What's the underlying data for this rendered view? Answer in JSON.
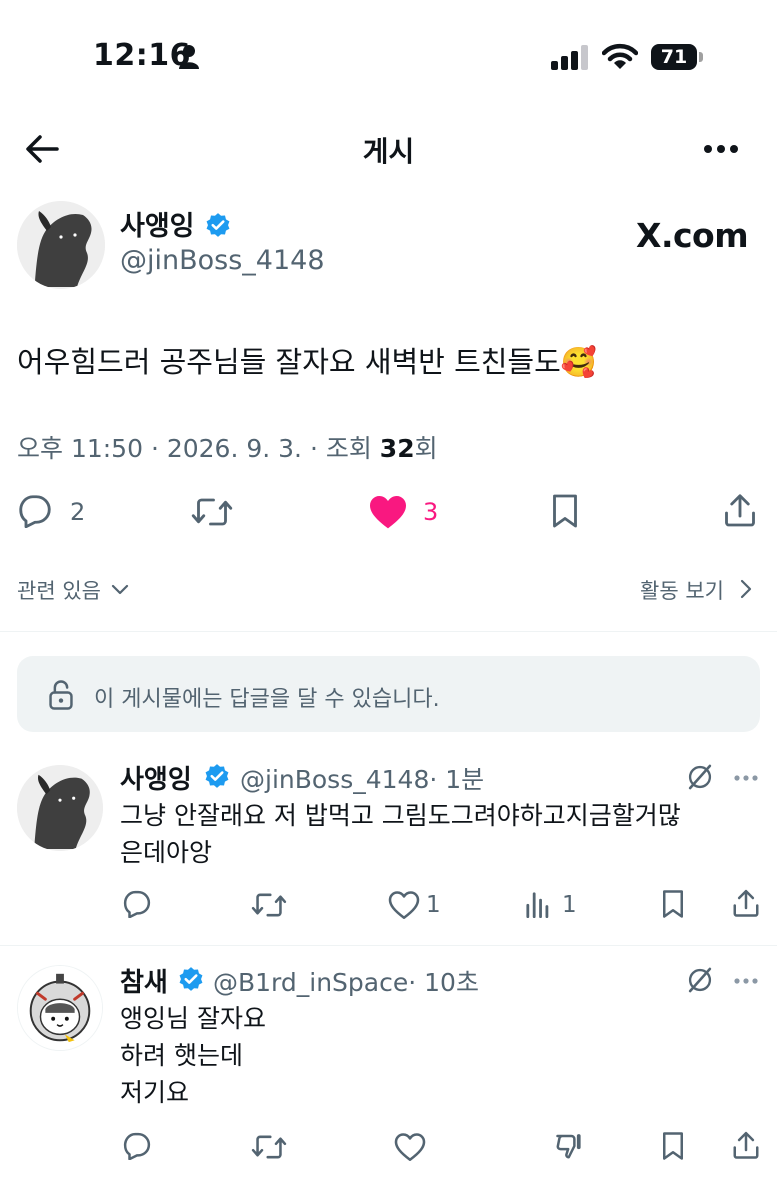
{
  "status_bar": {
    "time": "12:16",
    "battery": "71"
  },
  "header": {
    "title": "게시"
  },
  "post": {
    "author": {
      "name": "사앵잉",
      "handle": "@jinBoss_4148"
    },
    "source_logo": "X.com",
    "text": "어우힘드러 공주님들 잘자요 새벽반 트친들도🥰",
    "meta": {
      "prefix": "오후 11:50 · 2026. 9. 3. · 조회 ",
      "views": "32",
      "suffix": "회"
    },
    "actions": {
      "replies": "2",
      "likes": "3"
    }
  },
  "related_label": "관련 있음",
  "activity_label": "활동 보기",
  "reply_restriction": "이 게시물에는 답글을 달 수 있습니다.",
  "replies": [
    {
      "name": "사앵잉",
      "handle": "@jinBoss_4148",
      "time": "· 1분",
      "lines": [
        "그냥 안잘래요 저 밥먹고 그림도그려야하고지금할거많",
        "은데아앙"
      ],
      "likes": "1",
      "views": "1"
    },
    {
      "name": "참새",
      "handle": "@B1rd_inSpace",
      "time": "· 10초",
      "lines": [
        "앵잉님 잘자요",
        "하려 햇는데",
        "저기요"
      ]
    }
  ],
  "colors": {
    "text": "#0f1419",
    "secondary": "#536471",
    "like_active": "#f91880",
    "verified": "#1d9bf0",
    "divider": "#eff3f4"
  },
  "icons": [
    "back-arrow-icon",
    "more-icon",
    "verified-icon",
    "reply-icon",
    "retweet-icon",
    "heart-icon",
    "bookmark-icon",
    "share-icon",
    "chevron-down-icon",
    "chevron-right-icon",
    "lock-icon",
    "grok-icon",
    "views-icon",
    "dislike-icon"
  ]
}
